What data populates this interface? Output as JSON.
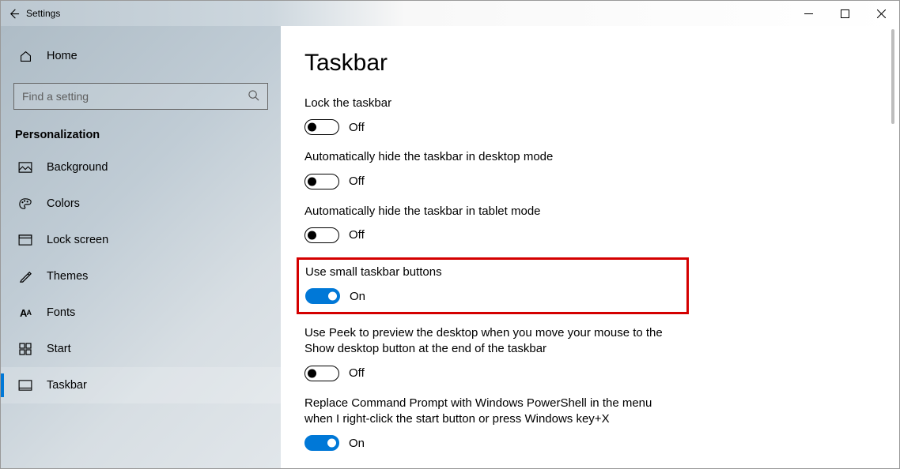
{
  "window": {
    "title": "Settings"
  },
  "window_controls": {
    "minimize": "minimize",
    "maximize": "maximize",
    "close": "close"
  },
  "sidebar": {
    "home": "Home",
    "search_placeholder": "Find a setting",
    "category": "Personalization",
    "items": [
      {
        "label": "Background",
        "icon": "image"
      },
      {
        "label": "Colors",
        "icon": "palette"
      },
      {
        "label": "Lock screen",
        "icon": "lockscreen"
      },
      {
        "label": "Themes",
        "icon": "themes"
      },
      {
        "label": "Fonts",
        "icon": "fonts"
      },
      {
        "label": "Start",
        "icon": "start"
      },
      {
        "label": "Taskbar",
        "icon": "taskbar",
        "selected": true
      }
    ]
  },
  "page": {
    "title": "Taskbar",
    "state_on": "On",
    "state_off": "Off",
    "settings": [
      {
        "label": "Lock the taskbar",
        "value": false
      },
      {
        "label": "Automatically hide the taskbar in desktop mode",
        "value": false
      },
      {
        "label": "Automatically hide the taskbar in tablet mode",
        "value": false
      },
      {
        "label": "Use small taskbar buttons",
        "value": true,
        "highlighted": true
      },
      {
        "label": "Use Peek to preview the desktop when you move your mouse to the Show desktop button at the end of the taskbar",
        "value": false
      },
      {
        "label": "Replace Command Prompt with Windows PowerShell in the menu when I right-click the start button or press Windows key+X",
        "value": true
      }
    ]
  }
}
